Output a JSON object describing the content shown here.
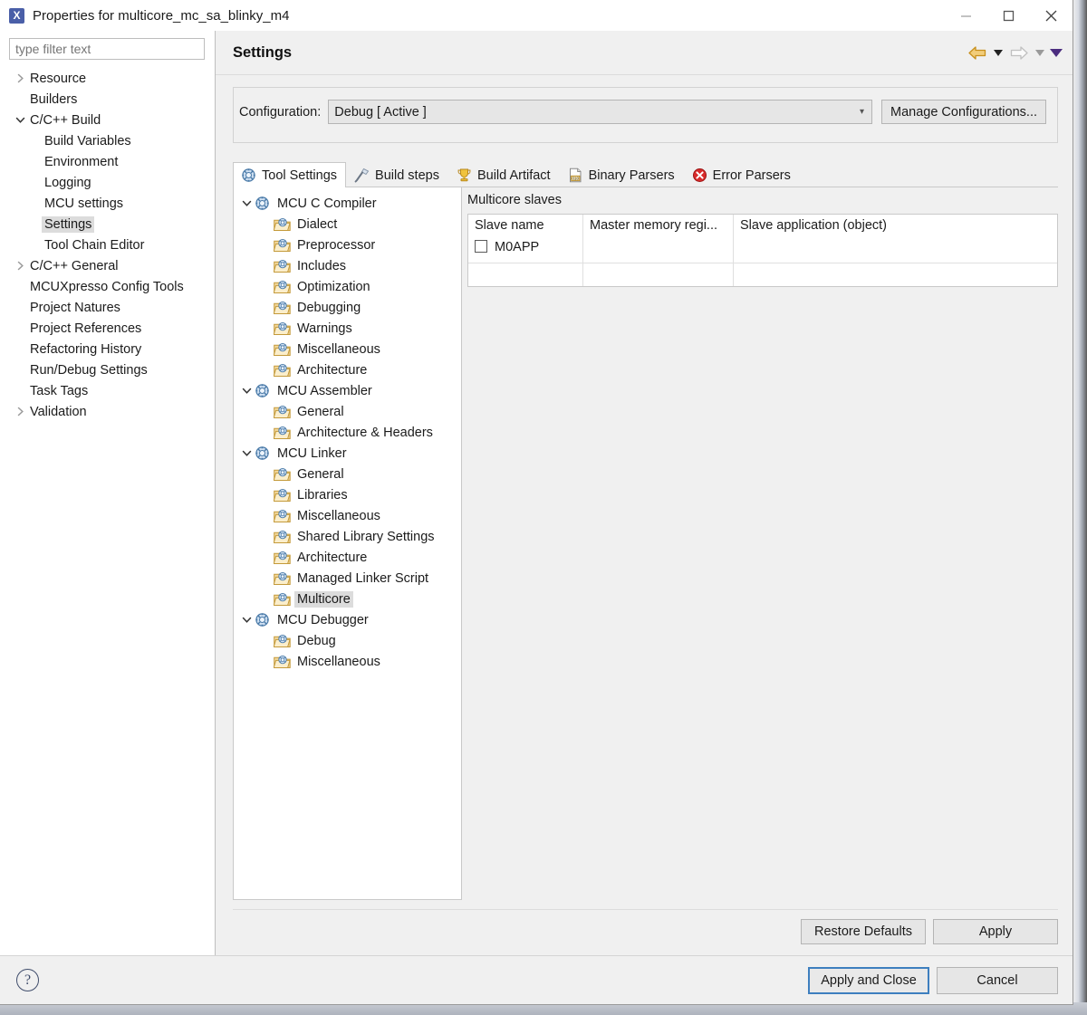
{
  "window": {
    "title": "Properties for multicore_mc_sa_blinky_m4",
    "app_icon": "eclipse-x-icon",
    "controls": {
      "minimize": "minimize-icon",
      "maximize": "maximize-icon",
      "close": "close-icon"
    }
  },
  "filter": {
    "placeholder": "type filter text",
    "value": ""
  },
  "nav_tree": [
    {
      "label": "Resource",
      "indent": 0,
      "arrow": "collapsed",
      "selected": false
    },
    {
      "label": "Builders",
      "indent": 0,
      "arrow": "none",
      "selected": false
    },
    {
      "label": "C/C++ Build",
      "indent": 0,
      "arrow": "expanded",
      "selected": false
    },
    {
      "label": "Build Variables",
      "indent": 1,
      "arrow": "none",
      "selected": false
    },
    {
      "label": "Environment",
      "indent": 1,
      "arrow": "none",
      "selected": false
    },
    {
      "label": "Logging",
      "indent": 1,
      "arrow": "none",
      "selected": false
    },
    {
      "label": "MCU settings",
      "indent": 1,
      "arrow": "none",
      "selected": false
    },
    {
      "label": "Settings",
      "indent": 1,
      "arrow": "none",
      "selected": true
    },
    {
      "label": "Tool Chain Editor",
      "indent": 1,
      "arrow": "none",
      "selected": false
    },
    {
      "label": "C/C++ General",
      "indent": 0,
      "arrow": "collapsed",
      "selected": false
    },
    {
      "label": "MCUXpresso Config Tools",
      "indent": 0,
      "arrow": "none",
      "selected": false
    },
    {
      "label": "Project Natures",
      "indent": 0,
      "arrow": "none",
      "selected": false
    },
    {
      "label": "Project References",
      "indent": 0,
      "arrow": "none",
      "selected": false
    },
    {
      "label": "Refactoring History",
      "indent": 0,
      "arrow": "none",
      "selected": false
    },
    {
      "label": "Run/Debug Settings",
      "indent": 0,
      "arrow": "none",
      "selected": false
    },
    {
      "label": "Task Tags",
      "indent": 0,
      "arrow": "none",
      "selected": false
    },
    {
      "label": "Validation",
      "indent": 0,
      "arrow": "collapsed",
      "selected": false
    }
  ],
  "page": {
    "title": "Settings",
    "back_icon": "back-arrow-icon",
    "forward_icon": "forward-arrow-icon",
    "menu_icon": "view-menu-icon"
  },
  "configuration": {
    "label": "Configuration:",
    "value": "Debug  [ Active ]",
    "manage_label": "Manage Configurations..."
  },
  "tabs": [
    {
      "label": "Tool Settings",
      "icon": "gear-wrench-icon",
      "active": true
    },
    {
      "label": "Build steps",
      "icon": "hammer-icon",
      "active": false
    },
    {
      "label": "Build Artifact",
      "icon": "trophy-icon",
      "active": false
    },
    {
      "label": "Binary Parsers",
      "icon": "binary-file-icon",
      "active": false
    },
    {
      "label": "Error Parsers",
      "icon": "error-circle-icon",
      "active": false
    }
  ],
  "tool_tree": [
    {
      "label": "MCU C Compiler",
      "level": 0,
      "arrow": "expanded",
      "icon": "tool-icon",
      "selected": false
    },
    {
      "label": "Dialect",
      "level": 1,
      "arrow": "none",
      "icon": "folder-icon",
      "selected": false
    },
    {
      "label": "Preprocessor",
      "level": 1,
      "arrow": "none",
      "icon": "folder-icon",
      "selected": false
    },
    {
      "label": "Includes",
      "level": 1,
      "arrow": "none",
      "icon": "folder-icon",
      "selected": false
    },
    {
      "label": "Optimization",
      "level": 1,
      "arrow": "none",
      "icon": "folder-icon",
      "selected": false
    },
    {
      "label": "Debugging",
      "level": 1,
      "arrow": "none",
      "icon": "folder-icon",
      "selected": false
    },
    {
      "label": "Warnings",
      "level": 1,
      "arrow": "none",
      "icon": "folder-icon",
      "selected": false
    },
    {
      "label": "Miscellaneous",
      "level": 1,
      "arrow": "none",
      "icon": "folder-icon",
      "selected": false
    },
    {
      "label": "Architecture",
      "level": 1,
      "arrow": "none",
      "icon": "folder-icon",
      "selected": false
    },
    {
      "label": "MCU Assembler",
      "level": 0,
      "arrow": "expanded",
      "icon": "tool-icon",
      "selected": false
    },
    {
      "label": "General",
      "level": 1,
      "arrow": "none",
      "icon": "folder-icon",
      "selected": false
    },
    {
      "label": "Architecture & Headers",
      "level": 1,
      "arrow": "none",
      "icon": "folder-icon",
      "selected": false
    },
    {
      "label": "MCU Linker",
      "level": 0,
      "arrow": "expanded",
      "icon": "tool-icon",
      "selected": false
    },
    {
      "label": "General",
      "level": 1,
      "arrow": "none",
      "icon": "folder-icon",
      "selected": false
    },
    {
      "label": "Libraries",
      "level": 1,
      "arrow": "none",
      "icon": "folder-icon",
      "selected": false
    },
    {
      "label": "Miscellaneous",
      "level": 1,
      "arrow": "none",
      "icon": "folder-icon",
      "selected": false
    },
    {
      "label": "Shared Library Settings",
      "level": 1,
      "arrow": "none",
      "icon": "folder-icon",
      "selected": false
    },
    {
      "label": "Architecture",
      "level": 1,
      "arrow": "none",
      "icon": "folder-icon",
      "selected": false
    },
    {
      "label": "Managed Linker Script",
      "level": 1,
      "arrow": "none",
      "icon": "folder-icon",
      "selected": false
    },
    {
      "label": "Multicore",
      "level": 1,
      "arrow": "none",
      "icon": "folder-icon",
      "selected": true
    },
    {
      "label": "MCU Debugger",
      "level": 0,
      "arrow": "expanded",
      "icon": "tool-icon",
      "selected": false
    },
    {
      "label": "Debug",
      "level": 1,
      "arrow": "none",
      "icon": "folder-icon",
      "selected": false
    },
    {
      "label": "Miscellaneous",
      "level": 1,
      "arrow": "none",
      "icon": "folder-icon",
      "selected": false
    }
  ],
  "panel": {
    "title": "Multicore slaves",
    "table": {
      "columns": [
        "Slave name",
        "Master memory regi...",
        "Slave application (object)"
      ],
      "rows": [
        {
          "slave_name": "M0APP",
          "checked": false,
          "master_memory_region": "",
          "slave_application": ""
        }
      ]
    }
  },
  "content_footer": {
    "restore_defaults": "Restore Defaults",
    "apply": "Apply"
  },
  "dialog_footer": {
    "help_icon": "help-icon",
    "apply_and_close": "Apply and Close",
    "cancel": "Cancel"
  },
  "colors": {
    "accent_blue": "#3e7fbf",
    "title_icon": "#4a5fa8",
    "back_arrow": "#d9a227",
    "forward_arrow": "#bdbdbd",
    "menu_caret": "#4b2d7f",
    "selection": "#dcdcdc",
    "error_icon": "#d92b2b",
    "trophy": "#e8b93c"
  }
}
